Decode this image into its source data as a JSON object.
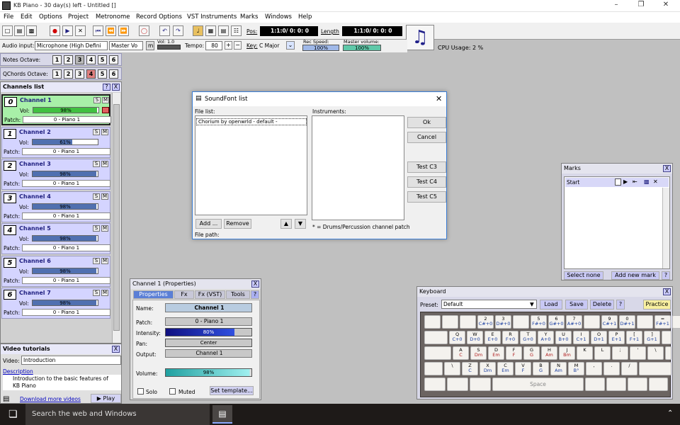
{
  "app": {
    "title": "KB Piano - 30 day(s) left - Untitled []",
    "window_controls": [
      "–",
      "❐",
      "✕"
    ]
  },
  "menu": [
    "File",
    "Edit",
    "Options",
    "Project",
    "Metronome",
    "Record Options",
    "VST Instruments",
    "Marks",
    "Windows",
    "Help"
  ],
  "toolbar": {
    "icons": [
      "new-file-icon",
      "open-folder-icon",
      "save-icon",
      "record-icon",
      "play-icon",
      "stop-icon",
      "go-start-icon",
      "rewind-icon",
      "fast-forward-icon",
      "metronome-icon",
      "undo-icon",
      "redo-icon",
      "key-edit-icon",
      "grid-icon",
      "bars-icon",
      "piano-roll-icon"
    ],
    "pos_label": "Pos:",
    "pos_value": "1:1:0/ 0: 0: 0",
    "length_label": "Length",
    "length_value": "1:1:0/ 0: 0: 0",
    "cpu_label": "CPU Usage: 2 %"
  },
  "toolbar2": {
    "audio_input_label": "Audio input:",
    "audio_input_value": "Microphone (High Defini",
    "master_value": "Master Vo",
    "m_label": "m",
    "vol_label": "Vol: 1.0",
    "tempo_label": "Tempo:",
    "tempo_value": "80",
    "key_label": "Key:",
    "key_value": "C Major",
    "rec_speed_label": "Rec Speed:",
    "rec_speed_value": "100%",
    "master_volume_label": "Master volume:",
    "master_volume_value": "100%"
  },
  "notes_octave": {
    "label": "Notes Octave:",
    "values": [
      "1",
      "2",
      "3",
      "4",
      "5",
      "6"
    ],
    "selected": "3"
  },
  "qchords_octave": {
    "label": "QChords Octave:",
    "values": [
      "1",
      "2",
      "3",
      "4",
      "5",
      "6"
    ],
    "selected": "4"
  },
  "channels": {
    "title": "Channels list",
    "help": "?",
    "close": "X",
    "items": [
      {
        "num": "0",
        "name": "Channel 1",
        "vol": "98%",
        "vol_level": 0.98,
        "patch": "0 - Piano 1",
        "active": true
      },
      {
        "num": "1",
        "name": "Channel 2",
        "vol": "61%",
        "vol_level": 0.61,
        "patch": "0 - Piano 1",
        "active": false
      },
      {
        "num": "2",
        "name": "Channel 3",
        "vol": "98%",
        "vol_level": 0.98,
        "patch": "0 - Piano 1",
        "active": false
      },
      {
        "num": "3",
        "name": "Channel 4",
        "vol": "98%",
        "vol_level": 0.98,
        "patch": "0 - Piano 1",
        "active": false
      },
      {
        "num": "4",
        "name": "Channel 5",
        "vol": "98%",
        "vol_level": 0.98,
        "patch": "0 - Piano 1",
        "active": false
      },
      {
        "num": "5",
        "name": "Channel 6",
        "vol": "98%",
        "vol_level": 0.98,
        "patch": "0 - Piano 1",
        "active": false
      },
      {
        "num": "6",
        "name": "Channel 7",
        "vol": "98%",
        "vol_level": 0.98,
        "patch": "0 - Piano 1",
        "active": false
      }
    ],
    "vol_label": "Vol:",
    "patch_label": "Patch:",
    "s": "S",
    "m": "M"
  },
  "video": {
    "title": "Video tutorials",
    "close": "X",
    "video_label": "Video:",
    "video_value": "Introduction",
    "description_link": "Description",
    "description_text": "Introduction to the basic features of KB Piano",
    "download_link": "Download more videos",
    "play": "Play"
  },
  "properties": {
    "title": "Channel 1 (Properties)",
    "close": "X",
    "tabs": [
      "Properties",
      "Fx",
      "Fx (VST)",
      "Tools",
      "?"
    ],
    "name_label": "Name:",
    "name_value": "Channel 1",
    "patch_label": "Patch:",
    "patch_value": "0 - Piano 1",
    "intensity_label": "Intensity:",
    "intensity_value": "80%",
    "pan_label": "Pan:",
    "pan_value": "Center",
    "output_label": "Output:",
    "output_value": "Channel 1",
    "volume_label": "Volume:",
    "volume_value": "98%",
    "solo": "Solo",
    "muted": "Muted",
    "set_template": "Set template..."
  },
  "soundfont": {
    "title": "SoundFont list",
    "close": "✕",
    "file_list_label": "File list:",
    "instruments_label": "Instruments:",
    "files": [
      "Chorium by openwrld - default -"
    ],
    "add": "Add ...",
    "remove": "Remove",
    "file_path_label": "File path:",
    "note": "* = Drums/Percussion channel patch",
    "ok": "Ok",
    "cancel": "Cancel",
    "test_c3": "Test C3",
    "test_c4": "Test C4",
    "test_c5": "Test C5"
  },
  "marks": {
    "title": "Marks",
    "close": "X",
    "items": [
      "Start"
    ],
    "select_none": "Select none",
    "add_new_mark": "Add new mark",
    "help": "?"
  },
  "keyboard": {
    "title": "Keyboard",
    "close": "X",
    "preset_label": "Preset:",
    "preset_value": "Default",
    "load": "Load",
    "save": "Save",
    "delete": "Delete",
    "help": "?",
    "practice": "Practice",
    "space": "Space",
    "row1": [
      [
        "",
        ""
      ],
      [
        "",
        ""
      ],
      [
        "2",
        "C#+0"
      ],
      [
        "3",
        "D#+0"
      ],
      [
        "",
        ""
      ],
      [
        "5",
        "F#+0"
      ],
      [
        "6",
        "G#+0"
      ],
      [
        "7",
        "A#+0"
      ],
      [
        "",
        ""
      ],
      [
        "9",
        "C#+1"
      ],
      [
        "0",
        "D#+1"
      ],
      [
        "",
        ""
      ],
      [
        "=",
        "F#+1"
      ]
    ],
    "row2": [
      [
        "Q",
        "C+0"
      ],
      [
        "W",
        "D+0"
      ],
      [
        "E",
        "E+0"
      ],
      [
        "R",
        "F+0"
      ],
      [
        "T",
        "G+0"
      ],
      [
        "Y",
        "A+0"
      ],
      [
        "U",
        "B+0"
      ],
      [
        "I",
        "C+1"
      ],
      [
        "O",
        "D+1"
      ],
      [
        "P",
        "E+1"
      ],
      [
        "[",
        "F+1"
      ],
      [
        "]",
        "G+1"
      ]
    ],
    "row3": [
      [
        "A",
        "C"
      ],
      [
        "S",
        "Dm"
      ],
      [
        "D",
        "Em"
      ],
      [
        "F",
        "F"
      ],
      [
        "G",
        "G"
      ],
      [
        "H",
        "Am"
      ],
      [
        "J",
        "Bm"
      ],
      [
        "K",
        ""
      ],
      [
        "L",
        ""
      ],
      [
        ";",
        ""
      ],
      [
        "'",
        ""
      ],
      [
        "\\",
        ""
      ]
    ],
    "row4": [
      [
        "\\",
        ""
      ],
      [
        "Z",
        "C"
      ],
      [
        "X",
        "Dm"
      ],
      [
        "C",
        "Em"
      ],
      [
        "V",
        "F"
      ],
      [
        "B",
        "G"
      ],
      [
        "N",
        "Am"
      ],
      [
        "M",
        "B°"
      ],
      [
        ",",
        ""
      ],
      [
        ".",
        ""
      ],
      [
        "/",
        ""
      ]
    ]
  },
  "taskbar": {
    "search": "Search the web and Windows"
  }
}
